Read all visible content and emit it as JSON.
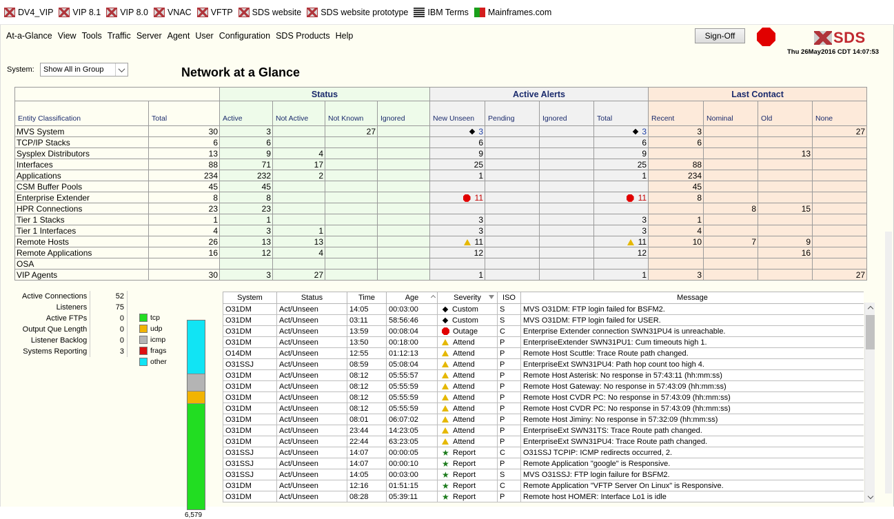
{
  "bookmarks": [
    {
      "label": "DV4_VIP",
      "icon": "sds-icon"
    },
    {
      "label": "VIP 8.1",
      "icon": "sds-icon"
    },
    {
      "label": "VIP 8.0",
      "icon": "sds-icon"
    },
    {
      "label": "VNAC",
      "icon": "sds-icon"
    },
    {
      "label": "VFTP",
      "icon": "sds-icon"
    },
    {
      "label": "SDS website",
      "icon": "sds-icon"
    },
    {
      "label": "SDS website prototype",
      "icon": "sds-icon"
    },
    {
      "label": "IBM Terms",
      "icon": "ibm-icon"
    },
    {
      "label": "Mainframes.com",
      "icon": "mainframes-icon"
    }
  ],
  "menu": [
    "At-a-Glance",
    "View",
    "Tools",
    "Traffic",
    "Server",
    "Agent",
    "User",
    "Configuration",
    "SDS Products",
    "Help"
  ],
  "header": {
    "signoff_label": "Sign-Off",
    "logo_text": "SDS",
    "datetime": "Thu 26May2016 CDT 14:07:53"
  },
  "system": {
    "label": "System:",
    "selected": "Show All in Group"
  },
  "title": "Network at a Glance",
  "glance": {
    "groups": {
      "status": "Status",
      "alerts": "Active Alerts",
      "last": "Last Contact"
    },
    "columns": [
      "Entity Classification",
      "Total",
      "Active",
      "Not Active",
      "Not Known",
      "Ignored",
      "New Unseen",
      "Pending",
      "Ignored",
      "Total",
      "Recent",
      "Nominal",
      "Old",
      "None"
    ],
    "rows": [
      {
        "name": "MVS System",
        "total": "30",
        "active": "3",
        "not_active": "",
        "not_known": "27",
        "ignored": "",
        "new_unseen": "3",
        "new_unseen_icon": "diamond",
        "pending": "",
        "al_ignored": "",
        "al_total": "3",
        "al_total_icon": "diamond",
        "al_color": "link",
        "recent": "3",
        "nominal": "",
        "old": "",
        "none": "27"
      },
      {
        "name": "TCP/IP Stacks",
        "total": "6",
        "active": "6",
        "not_active": "",
        "not_known": "",
        "ignored": "",
        "new_unseen": "6",
        "new_unseen_icon": "",
        "pending": "",
        "al_ignored": "",
        "al_total": "6",
        "al_total_icon": "",
        "al_color": "",
        "recent": "6",
        "nominal": "",
        "old": "",
        "none": ""
      },
      {
        "name": "Sysplex Distributors",
        "total": "13",
        "active": "9",
        "not_active": "4",
        "not_known": "",
        "ignored": "",
        "new_unseen": "9",
        "new_unseen_icon": "",
        "pending": "",
        "al_ignored": "",
        "al_total": "9",
        "al_total_icon": "",
        "al_color": "",
        "recent": "",
        "nominal": "",
        "old": "13",
        "none": ""
      },
      {
        "name": "Interfaces",
        "total": "88",
        "active": "71",
        "not_active": "17",
        "not_known": "",
        "ignored": "",
        "new_unseen": "25",
        "new_unseen_icon": "",
        "pending": "",
        "al_ignored": "",
        "al_total": "25",
        "al_total_icon": "",
        "al_color": "",
        "recent": "88",
        "nominal": "",
        "old": "",
        "none": ""
      },
      {
        "name": "Applications",
        "total": "234",
        "active": "232",
        "not_active": "2",
        "not_known": "",
        "ignored": "",
        "new_unseen": "1",
        "new_unseen_icon": "",
        "pending": "",
        "al_ignored": "",
        "al_total": "1",
        "al_total_icon": "",
        "al_color": "",
        "recent": "234",
        "nominal": "",
        "old": "",
        "none": ""
      },
      {
        "name": "CSM Buffer Pools",
        "total": "45",
        "active": "45",
        "not_active": "",
        "not_known": "",
        "ignored": "",
        "new_unseen": "",
        "new_unseen_icon": "",
        "pending": "",
        "al_ignored": "",
        "al_total": "",
        "al_total_icon": "",
        "al_color": "",
        "recent": "45",
        "nominal": "",
        "old": "",
        "none": ""
      },
      {
        "name": "Enterprise Extender",
        "total": "8",
        "active": "8",
        "not_active": "",
        "not_known": "",
        "ignored": "",
        "new_unseen": "11",
        "new_unseen_icon": "octagon",
        "pending": "",
        "al_ignored": "",
        "al_total": "11",
        "al_total_icon": "octagon",
        "al_color": "red",
        "recent": "8",
        "nominal": "",
        "old": "",
        "none": ""
      },
      {
        "name": "HPR Connections",
        "total": "23",
        "active": "23",
        "not_active": "",
        "not_known": "",
        "ignored": "",
        "new_unseen": "",
        "new_unseen_icon": "",
        "pending": "",
        "al_ignored": "",
        "al_total": "",
        "al_total_icon": "",
        "al_color": "",
        "recent": "",
        "nominal": "8",
        "old": "15",
        "none": ""
      },
      {
        "name": "Tier 1 Stacks",
        "total": "1",
        "active": "1",
        "not_active": "",
        "not_known": "",
        "ignored": "",
        "new_unseen": "3",
        "new_unseen_icon": "",
        "pending": "",
        "al_ignored": "",
        "al_total": "3",
        "al_total_icon": "",
        "al_color": "",
        "recent": "1",
        "nominal": "",
        "old": "",
        "none": ""
      },
      {
        "name": "Tier 1 Interfaces",
        "total": "4",
        "active": "3",
        "not_active": "1",
        "not_known": "",
        "ignored": "",
        "new_unseen": "3",
        "new_unseen_icon": "",
        "pending": "",
        "al_ignored": "",
        "al_total": "3",
        "al_total_icon": "",
        "al_color": "",
        "recent": "4",
        "nominal": "",
        "old": "",
        "none": ""
      },
      {
        "name": "Remote Hosts",
        "total": "26",
        "active": "13",
        "not_active": "13",
        "not_known": "",
        "ignored": "",
        "new_unseen": "11",
        "new_unseen_icon": "triangle",
        "pending": "",
        "al_ignored": "",
        "al_total": "11",
        "al_total_icon": "triangle",
        "al_color": "",
        "recent": "10",
        "nominal": "7",
        "old": "9",
        "none": ""
      },
      {
        "name": "Remote Applications",
        "total": "16",
        "active": "12",
        "not_active": "4",
        "not_known": "",
        "ignored": "",
        "new_unseen": "12",
        "new_unseen_icon": "",
        "pending": "",
        "al_ignored": "",
        "al_total": "12",
        "al_total_icon": "",
        "al_color": "",
        "recent": "",
        "nominal": "",
        "old": "16",
        "none": ""
      },
      {
        "name": "OSA",
        "total": "",
        "active": "",
        "not_active": "",
        "not_known": "",
        "ignored": "",
        "new_unseen": "",
        "new_unseen_icon": "",
        "pending": "",
        "al_ignored": "",
        "al_total": "",
        "al_total_icon": "",
        "al_color": "",
        "recent": "",
        "nominal": "",
        "old": "",
        "none": ""
      },
      {
        "name": "VIP Agents",
        "total": "30",
        "active": "3",
        "not_active": "27",
        "not_known": "",
        "ignored": "",
        "new_unseen": "1",
        "new_unseen_icon": "",
        "pending": "",
        "al_ignored": "",
        "al_total": "1",
        "al_total_icon": "",
        "al_color": "",
        "recent": "3",
        "nominal": "",
        "old": "",
        "none": "27"
      }
    ]
  },
  "connections": [
    {
      "label": "Active Connections",
      "value": "52"
    },
    {
      "label": "Listeners",
      "value": "75"
    },
    {
      "label": "Active FTPs",
      "value": "0"
    },
    {
      "label": "Output Que Length",
      "value": "0"
    },
    {
      "label": "Listener Backlog",
      "value": "0"
    },
    {
      "label": "Systems Reporting",
      "value": "3"
    }
  ],
  "traffic": {
    "legend": [
      {
        "label": "tcp",
        "color": "#22dd22"
      },
      {
        "label": "udp",
        "color": "#f2b400"
      },
      {
        "label": "icmp",
        "color": "#b4b4b4"
      },
      {
        "label": "frags",
        "color": "#dd1111"
      },
      {
        "label": "other",
        "color": "#11e4f4"
      }
    ],
    "stack_fractions_top_to_bottom": [
      {
        "label": "other",
        "fraction": 0.285
      },
      {
        "label": "icmp",
        "fraction": 0.09
      },
      {
        "label": "udp",
        "fraction": 0.065
      },
      {
        "label": "tcp",
        "fraction": 0.56
      }
    ],
    "total": "6,579"
  },
  "alerts": {
    "columns": [
      "System",
      "Status",
      "Time",
      "Age",
      "Severity",
      "ISO",
      "Message"
    ],
    "rows": [
      {
        "system": "O31DM",
        "status": "Act/Unseen",
        "time": "14:05",
        "age": "00:03:00",
        "severity": "Custom",
        "iso": "S",
        "message": "MVS O31DM: FTP login failed for BSFM2."
      },
      {
        "system": "O31DM",
        "status": "Act/Unseen",
        "time": "03:11",
        "age": "58:56:46",
        "severity": "Custom",
        "iso": "S",
        "message": "MVS O31DM: FTP login failed for USER."
      },
      {
        "system": "O31DM",
        "status": "Act/Unseen",
        "time": "13:59",
        "age": "00:08:04",
        "severity": "Outage",
        "iso": "C",
        "message": "Enterprise Extender connection SWN31PU4 is unreachable."
      },
      {
        "system": "O31DM",
        "status": "Act/Unseen",
        "time": "13:50",
        "age": "00:18:00",
        "severity": "Attend",
        "iso": "P",
        "message": "EnterpriseExtender SWN31PU1: Cum timeouts high 1."
      },
      {
        "system": "O14DM",
        "status": "Act/Unseen",
        "time": "12:55",
        "age": "01:12:13",
        "severity": "Attend",
        "iso": "P",
        "message": "Remote Host Scuttle: Trace Route path changed."
      },
      {
        "system": "O31SSJ",
        "status": "Act/Unseen",
        "time": "08:59",
        "age": "05:08:04",
        "severity": "Attend",
        "iso": "P",
        "message": "EnterpriseExt SWN31PU4: Path hop count too high 4."
      },
      {
        "system": "O31DM",
        "status": "Act/Unseen",
        "time": "08:12",
        "age": "05:55:57",
        "severity": "Attend",
        "iso": "P",
        "message": "Remote Host Asterisk: No response in 57:43:11 (hh:mm:ss)"
      },
      {
        "system": "O31DM",
        "status": "Act/Unseen",
        "time": "08:12",
        "age": "05:55:59",
        "severity": "Attend",
        "iso": "P",
        "message": "Remote Host Gateway: No response in 57:43:09 (hh:mm:ss)"
      },
      {
        "system": "O31DM",
        "status": "Act/Unseen",
        "time": "08:12",
        "age": "05:55:59",
        "severity": "Attend",
        "iso": "P",
        "message": "Remote Host CVDR PC: No response in 57:43:09 (hh:mm:ss)"
      },
      {
        "system": "O31DM",
        "status": "Act/Unseen",
        "time": "08:12",
        "age": "05:55:59",
        "severity": "Attend",
        "iso": "P",
        "message": "Remote Host CVDR PC: No response in 57:43:09 (hh:mm:ss)"
      },
      {
        "system": "O31DM",
        "status": "Act/Unseen",
        "time": "08:01",
        "age": "06:07:02",
        "severity": "Attend",
        "iso": "P",
        "message": "Remote Host Jiminy: No response in 57:32:09 (hh:mm:ss)"
      },
      {
        "system": "O31DM",
        "status": "Act/Unseen",
        "time": "23:44",
        "age": "14:23:05",
        "severity": "Attend",
        "iso": "P",
        "message": "EnterpriseExt SWN31TS: Trace Route path changed."
      },
      {
        "system": "O31DM",
        "status": "Act/Unseen",
        "time": "22:44",
        "age": "63:23:05",
        "severity": "Attend",
        "iso": "P",
        "message": "EnterpriseExt SWN31PU4: Trace Route path changed."
      },
      {
        "system": "O31SSJ",
        "status": "Act/Unseen",
        "time": "14:07",
        "age": "00:00:05",
        "severity": "Report",
        "iso": "C",
        "message": "O31SSJ TCPIP: ICMP redirects occurred, 2."
      },
      {
        "system": "O31SSJ",
        "status": "Act/Unseen",
        "time": "14:07",
        "age": "00:00:10",
        "severity": "Report",
        "iso": "P",
        "message": "Remote Application \"google\" is Responsive."
      },
      {
        "system": "O31SSJ",
        "status": "Act/Unseen",
        "time": "14:05",
        "age": "00:03:00",
        "severity": "Report",
        "iso": "S",
        "message": "MVS O31SSJ: FTP login failure for BSFM2."
      },
      {
        "system": "O31DM",
        "status": "Act/Unseen",
        "time": "12:16",
        "age": "01:51:15",
        "severity": "Report",
        "iso": "C",
        "message": "Remote Application \"VFTP Server On Linux\" is Responsive."
      },
      {
        "system": "O31DM",
        "status": "Act/Unseen",
        "time": "08:28",
        "age": "05:39:11",
        "severity": "Report",
        "iso": "P",
        "message": "Remote host HOMER: Interface Lo1 is idle"
      }
    ]
  }
}
